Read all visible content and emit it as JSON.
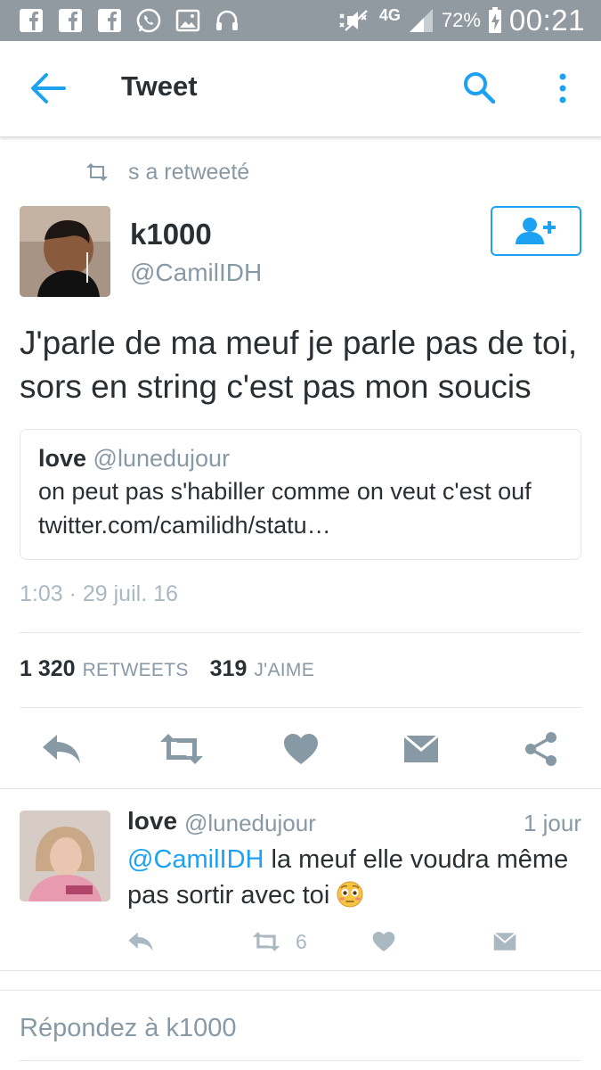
{
  "status_bar": {
    "network": "4G",
    "battery_percent": "72%",
    "time": "00:21",
    "notification_icons": [
      "facebook-icon",
      "facebook-icon",
      "facebook-icon",
      "whatsapp-icon",
      "gallery-icon",
      "headphones-icon"
    ]
  },
  "toolbar": {
    "title": "Tweet",
    "back_icon": "arrow-left-icon",
    "search_icon": "search-icon",
    "more_icon": "more-vertical-icon"
  },
  "tweet": {
    "retweet_context": "s a retweeté",
    "author_name": "k1000",
    "author_handle": "@CamilIDH",
    "text": "J'parle de ma meuf je parle pas de toi, sors en string c'est pas mon soucis",
    "quote": {
      "name": "love",
      "handle": "@lunedujour",
      "text": "on peut pas s'habiller comme on veut c'est ouf twitter.com/camilidh/statu…"
    },
    "timestamp": "1:03 · 29 juil. 16",
    "retweets_count": "1 320",
    "retweets_label": "RETWEETS",
    "likes_count": "319",
    "likes_label": "J'AIME"
  },
  "reply": {
    "name": "love",
    "handle": "@lunedujour",
    "time": "1 jour",
    "mention": "@CamilIDH",
    "text": " la meuf elle voudra même pas sortir avec toi ",
    "retweet_count": "6"
  },
  "compose": {
    "placeholder": "Répondez à k1000"
  },
  "colors": {
    "accent": "#1da1f2",
    "action_gray": "#8899a6",
    "light_gray": "#aab8c2",
    "status_bar": "#919aa1"
  }
}
